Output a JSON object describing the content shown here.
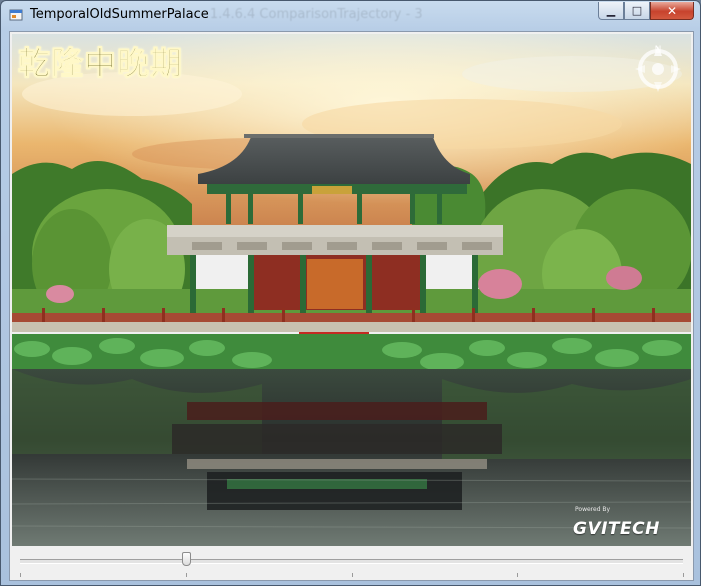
{
  "window": {
    "title": "TemporalOldSummerPalace",
    "ghost_title": "- 1.4.6.4 ComparisonTrajectory - 3",
    "controls": {
      "minimize": "▁",
      "maximize": "□",
      "close": "✕"
    }
  },
  "viewport": {
    "overlay_title": "乾隆中晚期",
    "compass_letter": "N",
    "powered_by": "Powered By",
    "brand": "GVITECH"
  },
  "trackbar": {
    "value_fraction": 0.25,
    "tick_count": 5
  },
  "colors": {
    "sky_top": "#d7e2e6",
    "sky_glow": "#f1c77a",
    "foliage": "#4c8a2c",
    "water": "#2b3130",
    "pillar_red": "#a8321f",
    "lotus": "#4ea64a"
  }
}
